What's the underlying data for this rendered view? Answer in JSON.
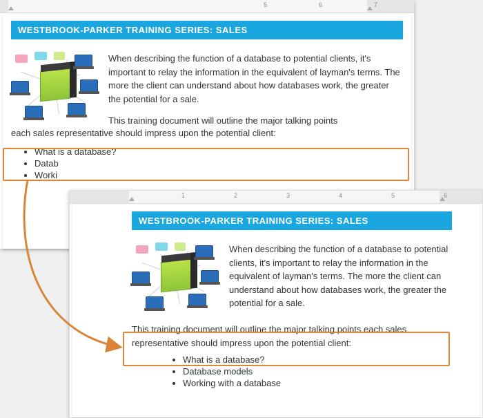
{
  "doc": {
    "title": "WESTBROOK-PARKER TRAINING SERIES: SALES",
    "para1": "When describing the function of a database to potential clients, it's important to relay the information in the equivalent of layman's terms. The more the client can understand about how databases work, the greater the potential for a sale.",
    "para2": "This training document will outline the major talking points each sales representative should impress upon the potential client:",
    "bullets_back": [
      "What is a database?",
      "Datab",
      "Worki"
    ],
    "bullets_front": [
      "What is a database?",
      "Database models",
      "Working with a database"
    ]
  },
  "ruler": {
    "back": {
      "ticks": [
        "5",
        "6",
        "7"
      ],
      "right_margin_from_tick": "6"
    },
    "front": {
      "ticks": [
        "1",
        "2",
        "3",
        "4",
        "5",
        "6"
      ],
      "right_margin_from_tick": "6"
    }
  },
  "illustration": {
    "name": "server-and-devices-cluster",
    "devices": [
      "server",
      "laptop",
      "laptop",
      "laptop",
      "laptop",
      "laptop",
      "phone-pink",
      "phone-cyan",
      "tablet-lime"
    ]
  },
  "colors": {
    "title_bg": "#1aa7e0",
    "highlight_border": "#d98437",
    "arrow": "#d98437"
  }
}
